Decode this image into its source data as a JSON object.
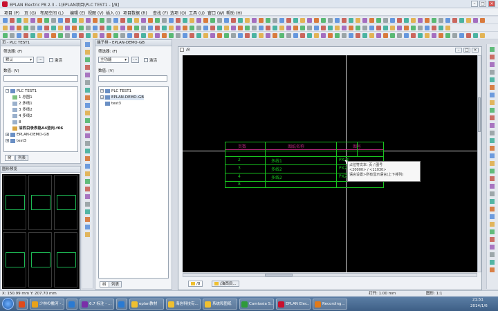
{
  "window": {
    "title": "EPLAN Electric P8 2.3 - 1\\EPLAN项目\\PLC TEST1 - [/8]"
  },
  "menu": [
    "项目 (P)",
    "页 (G)",
    "布局空间 (L)",
    "编辑 (E)",
    "视图 (V)",
    "插入 (I)",
    "项目数据 (R)",
    "查找 (F)",
    "选项 (O)",
    "工具 (U)",
    "窗口 (W)",
    "帮助 (H)"
  ],
  "page_panel": {
    "title": "页 - PLC TEST1",
    "filter_label": "筛选器: (F)",
    "filter_value": "默认",
    "activate_label": "激活",
    "value_label": "数值: (V)",
    "tree": [
      {
        "label": "PLC TEST1",
        "level": 0,
        "bold": false
      },
      {
        "label": "1 总图1",
        "level": 1,
        "bold": false
      },
      {
        "label": "2 多线1",
        "level": 1,
        "bold": false
      },
      {
        "label": "3 多线2",
        "level": 1,
        "bold": false
      },
      {
        "label": "4 多线2",
        "level": 1,
        "bold": false
      },
      {
        "label": "8",
        "level": 1,
        "bold": false
      },
      {
        "label": "油西目录表格A4竖向.f06",
        "level": 1,
        "bold": true
      },
      {
        "label": "EPLAN-DEMO-GB",
        "level": 0,
        "bold": false
      },
      {
        "label": "test3",
        "level": 0,
        "bold": false
      }
    ],
    "tabs": [
      "树",
      "列表"
    ]
  },
  "terminal_panel": {
    "title": "端子排 - EPLAN-DEMO-GB",
    "filter_label": "筛选器: (F)",
    "filter_value": "主功能",
    "activate_label": "激活",
    "value_label": "数值: (V)",
    "tree": [
      {
        "label": "PLC TEST1"
      },
      {
        "label": "EPLAN-DEMO-GB"
      },
      {
        "label": "test3"
      }
    ],
    "tabs": [
      "树",
      "列表"
    ]
  },
  "preview_panel": {
    "title": "图形预览"
  },
  "document": {
    "tab_title": "/8",
    "bottom_tabs": [
      "/8",
      "/油西目..."
    ],
    "table": {
      "headers": [
        "页数",
        "图纸名称",
        "图号"
      ],
      "rows": [
        {
          "page": "2",
          "name": "多线1",
          "code": "PX20"
        },
        {
          "page": "3",
          "name": "多线2",
          "code": "PX20"
        },
        {
          "page": "4",
          "name": "多线2",
          "code": "PX20"
        },
        {
          "page": "8",
          "name": "",
          "code": ""
        }
      ]
    },
    "tooltip": [
      "占位符文本: 页 / 图号",
      "<20000> / <11030>",
      "语言设置>所有显示语言(上下排列)"
    ]
  },
  "status": {
    "coords": "X: 150.99 mm   Y: 207.70 mm",
    "open": "打开: 1.00 mm",
    "scale": "图形: 1:1"
  },
  "taskbar": {
    "items": [
      {
        "label": "",
        "color": "#e04a1b"
      },
      {
        "label": "少林の撇河 - ...",
        "color": "#e9a21a"
      },
      {
        "label": "",
        "color": "#2a7ad2"
      },
      {
        "label": "6.7 标注 - ...",
        "color": "#7a2fa8"
      },
      {
        "label": "",
        "color": "#2a7ad2"
      },
      {
        "label": "eplan教材",
        "color": "#f0c030"
      },
      {
        "label": "海信科技有...",
        "color": "#f0c030"
      },
      {
        "label": "系统和图纸",
        "color": "#f0c030"
      },
      {
        "label": "Camtasia S...",
        "color": "#2f9a3a"
      },
      {
        "label": "EPLAN Elec...",
        "color": "#c8102e"
      },
      {
        "label": "Recording...",
        "color": "#e07a1a"
      }
    ],
    "time": "21:51",
    "date": "2014/1/6"
  }
}
